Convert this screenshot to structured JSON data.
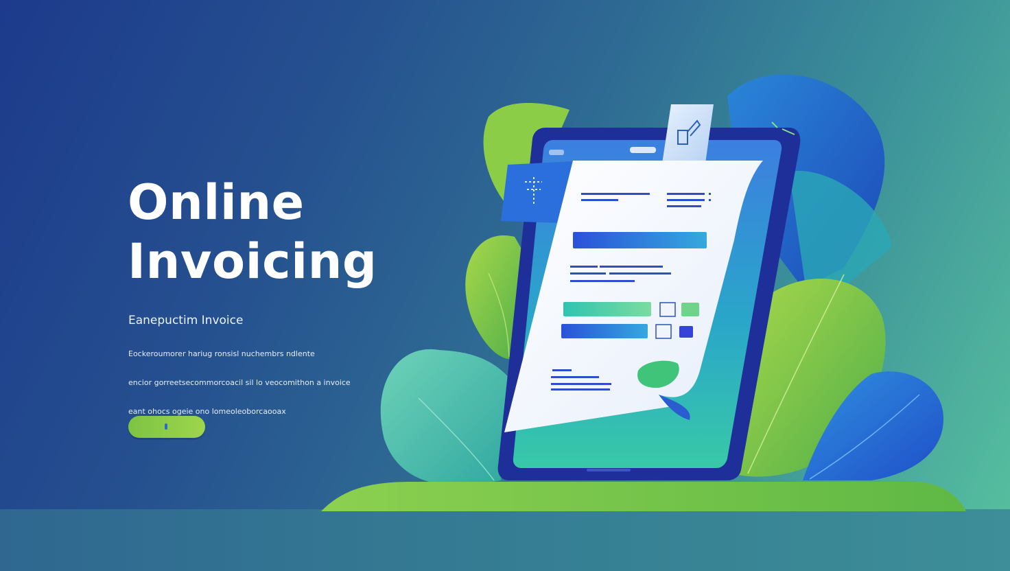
{
  "hero": {
    "title_line1": "Online",
    "title_line2": "Invoicing",
    "subtitle": "Eanepuctim Invoice",
    "description_lines": [
      "Eockeroumorer hariug ronsisl nuchembrs ndlente",
      "encior gorreetsecommorcoacil sil lo veocomithon a invoice",
      "eant ohocs ogeie ono lomeoleoborcaooax"
    ],
    "cta_label": ""
  },
  "colors": {
    "background_start": "#1d3a8c",
    "background_end": "#58c29f",
    "accent_green": "#8bcb45",
    "accent_blue": "#2d6ac8",
    "tablet_frame": "#1e2f9a"
  },
  "icons": {
    "tablet": "tablet-icon",
    "invoice": "invoice-document-icon",
    "edit": "edit-checkbox-icon",
    "leaves": "leaf-decoration-icon"
  }
}
